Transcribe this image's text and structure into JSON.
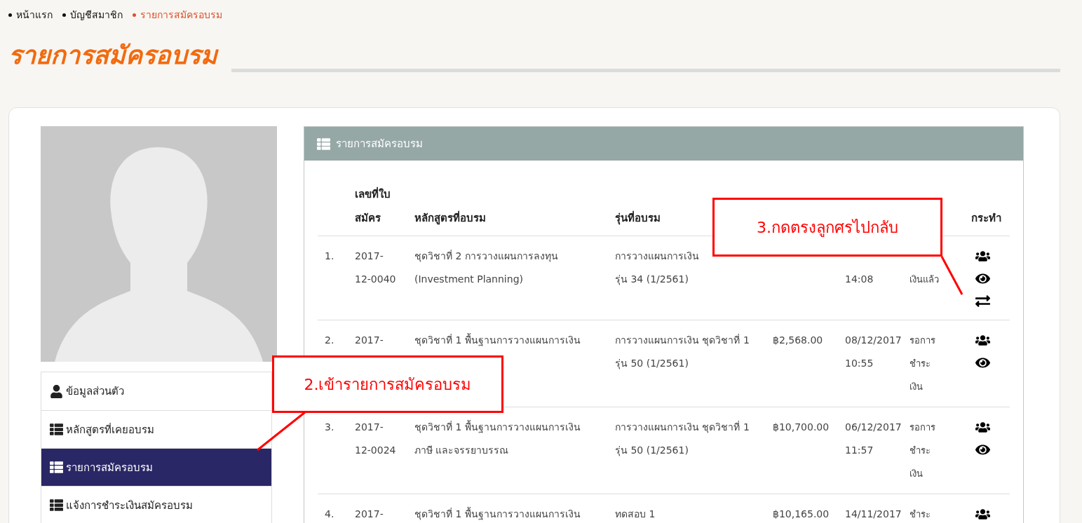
{
  "breadcrumb": [
    {
      "label": "หน้าแรก",
      "selected": false
    },
    {
      "label": "บัญชีสมาชิก",
      "selected": false
    },
    {
      "label": "รายการสมัครอบรม",
      "selected": true
    }
  ],
  "page_title": "รายการสมัครอบรม",
  "menu": [
    {
      "label": "ข้อมูลส่วนตัว",
      "kind": "person",
      "selected": false
    },
    {
      "label": "หลักสูตรที่เคยอบรม",
      "kind": "list",
      "selected": false
    },
    {
      "label": "รายการสมัครอบรม",
      "kind": "list",
      "selected": true
    },
    {
      "label": "แจ้งการชำระเงินสมัครอบรม",
      "kind": "list",
      "selected": false
    }
  ],
  "panel": {
    "title": "รายการสมัครอบรม"
  },
  "header": {
    "application_no": "เลขที่ใบ\nสมัคร",
    "course": "หลักสูตรที่อบรม",
    "batch": "รุ่นที่อบรม",
    "actions": "กระทำ"
  },
  "rows": [
    {
      "number": "1.",
      "application_no": "2017-\n12-0040",
      "course": "ชุดวิชาที่ 2 การวางแผนการลงทุน\n(Investment Planning)",
      "batch": "การวางแผนการเงิน\nรุ่น 34 (1/2561)",
      "date": "\n14:08",
      "status": "\nเงินแล้ว",
      "actions": [
        {
          "kind": "members"
        },
        {
          "kind": "view"
        },
        {
          "kind": "swap"
        }
      ]
    },
    {
      "number": "2.",
      "application_no": "2017-",
      "course": "ชุดวิชาที่ 1 พื้นฐานการวางแผนการเงิน",
      "batch": "การวางแผนการเงิน ชุดวิชาที่ 1\nรุ่น 50 (1/2561)",
      "price": "฿2,568.00",
      "date": "08/12/2017\n10:55",
      "status": "รอการ\nชำระ\nเงิน",
      "actions": [
        {
          "kind": "members"
        },
        {
          "kind": "view"
        }
      ]
    },
    {
      "number": "3.",
      "application_no": "2017-\n12-0024",
      "course": "ชุดวิชาที่ 1 พื้นฐานการวางแผนการเงิน\nภาษี และจรรยาบรรณ",
      "batch": "การวางแผนการเงิน ชุดวิชาที่ 1\nรุ่น 50 (1/2561)",
      "price": "฿10,700.00",
      "date": "06/12/2017\n11:57",
      "status": "รอการ\nชำระ\nเงิน",
      "actions": [
        {
          "kind": "members"
        },
        {
          "kind": "view"
        }
      ]
    },
    {
      "number": "4.",
      "application_no": "2017-",
      "course": "ชุดวิชาที่ 1 พื้นฐานการวางแผนการเงิน",
      "batch": "ทดสอบ 1",
      "price": "฿10,165.00",
      "date": "14/11/2017",
      "status": "ชำระ",
      "actions": [
        {
          "kind": "members"
        }
      ]
    }
  ],
  "callouts": [
    {
      "text": "3.กดตรงลูกศรไปกลับ",
      "kind": "top"
    },
    {
      "text": "2.เข้ารายการสมัครอบรม",
      "kind": "bottom"
    }
  ]
}
